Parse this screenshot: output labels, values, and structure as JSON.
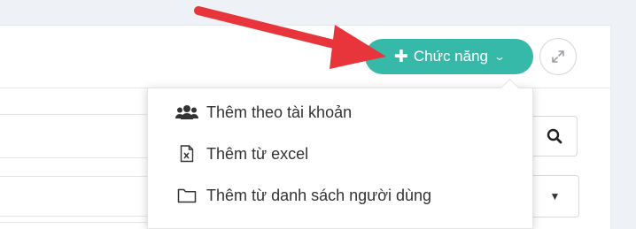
{
  "toolbar": {
    "functions_label": "Chức năng",
    "functions_icon": "plus-icon",
    "expand_icon": "expand-icon"
  },
  "dropdown": {
    "items": [
      {
        "label": "Thêm theo tài khoản",
        "icon": "users-icon"
      },
      {
        "label": "Thêm từ excel",
        "icon": "file-excel-icon"
      },
      {
        "label": "Thêm từ danh sách người dùng",
        "icon": "folder-icon"
      }
    ]
  },
  "filters": {
    "search_icon": "search-icon",
    "select_icon": "caret-down-icon",
    "select_caret_glyph": "▼"
  },
  "annotation": {
    "arrow_color": "#e8353b"
  },
  "colors": {
    "accent": "#36b9a8",
    "background": "#eef1f5",
    "arrow": "#e8353b"
  }
}
